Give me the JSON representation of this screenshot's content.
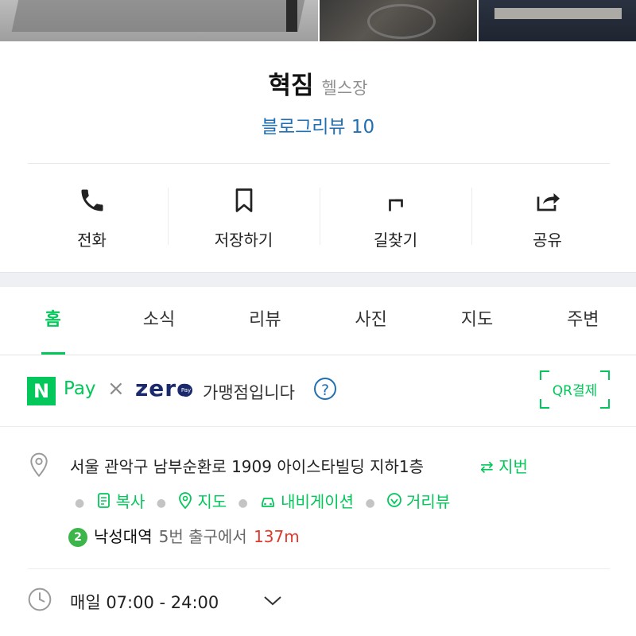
{
  "place": {
    "name": "혁짐",
    "category": "헬스장",
    "blog_review": "블로그리뷰 10"
  },
  "actions": [
    {
      "label": "전화",
      "icon": "phone-icon"
    },
    {
      "label": "저장하기",
      "icon": "bookmark-icon"
    },
    {
      "label": "길찾기",
      "icon": "directions-icon"
    },
    {
      "label": "공유",
      "icon": "share-icon"
    }
  ],
  "tabs": [
    {
      "label": "홈",
      "active": true
    },
    {
      "label": "소식",
      "active": false
    },
    {
      "label": "리뷰",
      "active": false
    },
    {
      "label": "사진",
      "active": false
    },
    {
      "label": "지도",
      "active": false
    },
    {
      "label": "주변",
      "active": false
    }
  ],
  "payment": {
    "npay_mark": "N",
    "npay_text": "Pay",
    "cross": "×",
    "zero_text": "zero",
    "zero_dot": "Pay",
    "franchise": "가맹점입니다",
    "help": "?",
    "qr_label": "QR결제"
  },
  "location": {
    "address": "서울 관악구 남부순환로 1909 아이스타빌딩 지하1층",
    "jibeon": "⇄ 지번",
    "copy": "복사",
    "map": "지도",
    "navigation": "내비게이션",
    "street_view": "거리뷰",
    "subway_line": "2",
    "subway_line_color": "#3cb54a",
    "station": "낙성대역",
    "exit": "5번 출구에서",
    "distance": "137m"
  },
  "hours": {
    "text": "매일 07:00 - 24:00"
  },
  "colors": {
    "accent": "#03c75a",
    "link": "#1f6fb3",
    "distance": "#e0392b"
  }
}
